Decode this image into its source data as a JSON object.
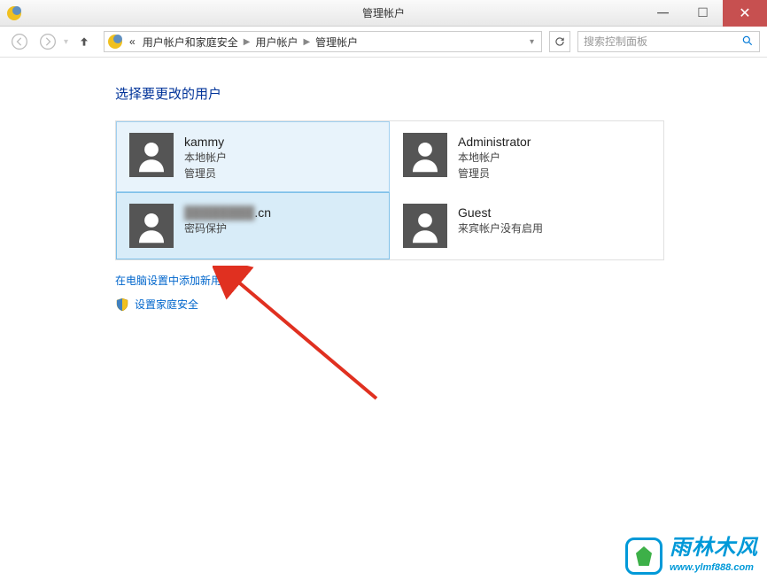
{
  "titlebar": {
    "title": "管理帐户"
  },
  "navbar": {
    "breadcrumb_prefix": "«",
    "breadcrumb": [
      "用户帐户和家庭安全",
      "用户帐户",
      "管理帐户"
    ],
    "search_placeholder": "搜索控制面板"
  },
  "content": {
    "heading": "选择要更改的用户"
  },
  "accounts": [
    {
      "name": "kammy",
      "type": "本地帐户",
      "role": "管理员",
      "selected": true,
      "highlighted": false
    },
    {
      "name": "Administrator",
      "type": "本地帐户",
      "role": "管理员",
      "selected": false,
      "highlighted": false
    },
    {
      "name": "​",
      "name_suffix": ".cn",
      "type": "密码保护",
      "role": "",
      "selected": false,
      "highlighted": true,
      "blurred": true
    },
    {
      "name": "Guest",
      "type": "来宾帐户没有启用",
      "role": "",
      "selected": false,
      "highlighted": false
    }
  ],
  "links": {
    "add_user": "在电脑设置中添加新用户",
    "family_safety": "设置家庭安全"
  },
  "watermark": {
    "brand": "雨林木风",
    "url": "www.ylmf888.com"
  }
}
